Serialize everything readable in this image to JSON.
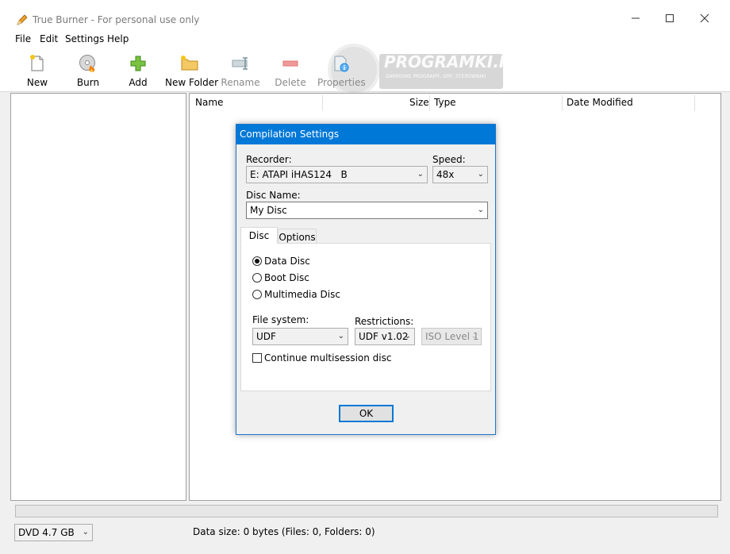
{
  "window": {
    "title": "True Burner - For personal use only"
  },
  "menu": [
    "File",
    "Edit",
    "Settings",
    "Help"
  ],
  "toolbar": {
    "new": "New",
    "burn": "Burn",
    "add": "Add",
    "new_folder": "New Folder",
    "rename": "Rename",
    "delete": "Delete",
    "properties": "Properties"
  },
  "watermark": {
    "brand": "PROGRAMKI.PL",
    "tagline": "DARMOWE PROGRAMY, GRY, STEROWNIKI"
  },
  "file_list": {
    "columns": [
      "Name",
      "Size",
      "Type",
      "Date Modified"
    ]
  },
  "status": {
    "disc_type": "DVD 4.7 GB",
    "data_size": "Data size: 0 bytes (Files: 0, Folders: 0)"
  },
  "dialog": {
    "title": "Compilation Settings",
    "recorder_label": "Recorder:",
    "recorder_value": "E: ATAPI iHAS124   B",
    "speed_label": "Speed:",
    "speed_value": "48x",
    "disc_name_label": "Disc Name:",
    "disc_name_value": "My Disc",
    "tabs": [
      "Disc",
      "Options"
    ],
    "disc_types": [
      "Data Disc",
      "Boot Disc",
      "Multimedia Disc"
    ],
    "selected_disc_type": "Data Disc",
    "file_system_label": "File system:",
    "file_system_value": "UDF",
    "restrictions_label": "Restrictions:",
    "restrictions_value": "UDF v1.02",
    "iso_level_value": "ISO Level 1",
    "multisession_label": "Continue multisession disc",
    "multisession_checked": false,
    "ok_label": "OK"
  }
}
